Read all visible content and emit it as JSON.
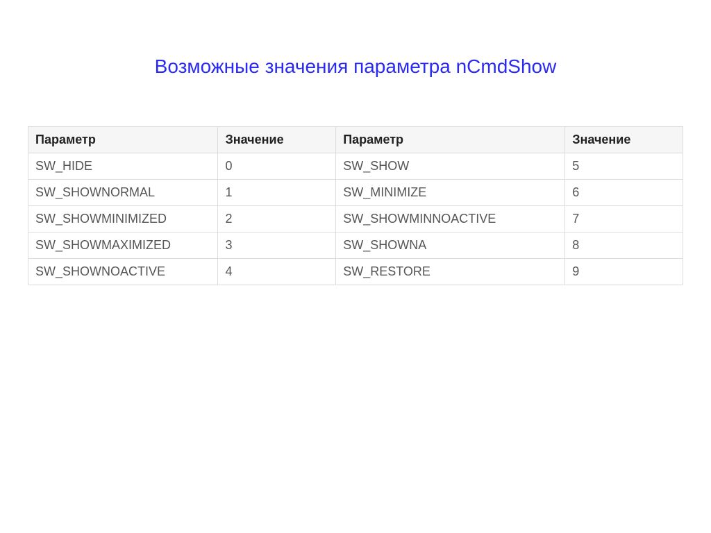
{
  "title": "Возможные значения параметра nCmdShow",
  "headers": {
    "param1": "Параметр",
    "value1": "Значение",
    "param2": "Параметр",
    "value2": "Значение"
  },
  "rows": [
    {
      "p1": "SW_HIDE",
      "v1": "0",
      "p2": "SW_SHOW",
      "v2": "5"
    },
    {
      "p1": "SW_SHOWNORMAL",
      "v1": "1",
      "p2": "SW_MINIMIZE",
      "v2": "6"
    },
    {
      "p1": "SW_SHOWMINIMIZED",
      "v1": "2",
      "p2": "SW_SHOWMINNOACTIVE",
      "v2": "7"
    },
    {
      "p1": "SW_SHOWMAXIMIZED",
      "v1": "3",
      "p2": "SW_SHOWNA",
      "v2": "8"
    },
    {
      "p1": "SW_SHOWNOACTIVE",
      "v1": "4",
      "p2": "SW_RESTORE",
      "v2": "9"
    }
  ]
}
